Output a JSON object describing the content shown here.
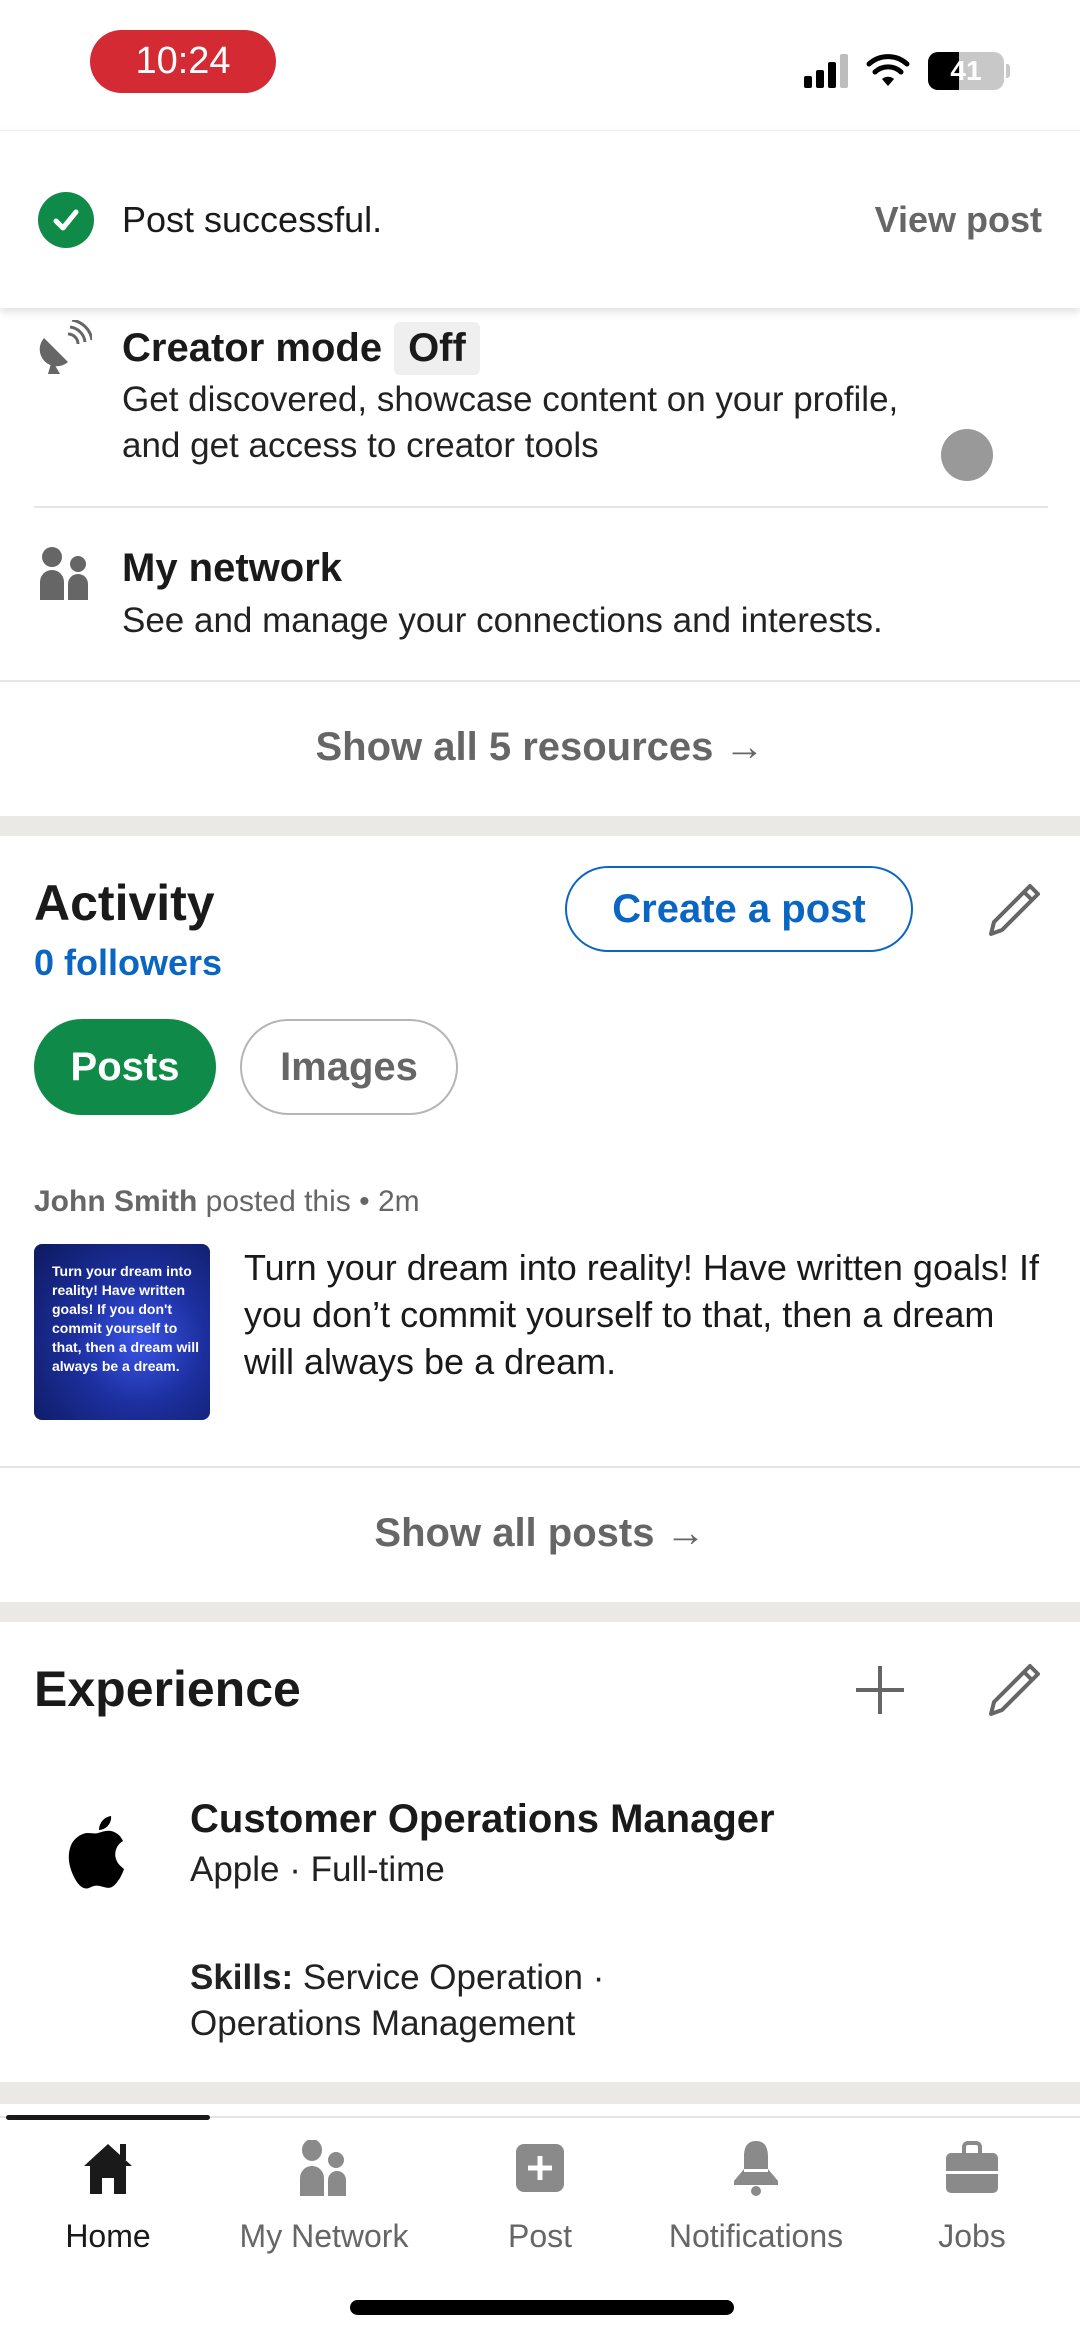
{
  "status_bar": {
    "time": "10:24",
    "battery_level": "41",
    "battery_percent": 41,
    "signal_bars": 3,
    "signal_max": 4,
    "time_pill_color": "#d42a33"
  },
  "toast": {
    "icon": "check-circle-icon",
    "message": "Post successful.",
    "action_label": "View post",
    "accent_color": "#0f8a48"
  },
  "resources": {
    "items": [
      {
        "icon": "satellite-dish-icon",
        "title": "Creator mode",
        "badge": "Off",
        "description_line1": "Get discovered, showcase content on your profile,",
        "description_line2": "and get access to creator tools"
      },
      {
        "icon": "people-icon",
        "title": "My network",
        "description_line1": "See and manage your connections and interests."
      }
    ],
    "show_all_label": "Show all 5 resources →"
  },
  "activity": {
    "title": "Activity",
    "followers": "0 followers",
    "create_post_label": "Create a post",
    "edit_icon": "pencil-icon",
    "filters": [
      {
        "label": "Posts",
        "active": true
      },
      {
        "label": "Images",
        "active": false
      }
    ],
    "post": {
      "author": "John Smith",
      "action": " posted this • 2m",
      "thumbnail_text": "Turn your dream into reality! Have written goals! If you don't commit yourself to that, then a dream will always be a dream.",
      "text": "Turn your dream into reality! Have written goals! If you don’t commit yourself to that, then a dream will always be a dream."
    },
    "show_all_label": "Show all posts →",
    "brand_color": "#0a66c2",
    "active_chip_color": "#0f8a48"
  },
  "experience": {
    "title": "Experience",
    "add_icon": "plus-icon",
    "edit_icon": "pencil-icon",
    "entries": [
      {
        "logo": "apple-logo-icon",
        "role": "Customer Operations Manager",
        "company_line": "Apple · Full-time",
        "skills_label": "Skills:",
        "skills_line1": " Service Operation ·",
        "skills_line2": "Operations Management"
      }
    ]
  },
  "bottom_nav": {
    "items": [
      {
        "label": "Home",
        "icon": "home-icon",
        "active": true
      },
      {
        "label": "My Network",
        "icon": "people-icon",
        "active": false
      },
      {
        "label": "Post",
        "icon": "plus-square-icon",
        "active": false
      },
      {
        "label": "Notifications",
        "icon": "bell-icon",
        "active": false
      },
      {
        "label": "Jobs",
        "icon": "briefcase-icon",
        "active": false
      }
    ]
  }
}
